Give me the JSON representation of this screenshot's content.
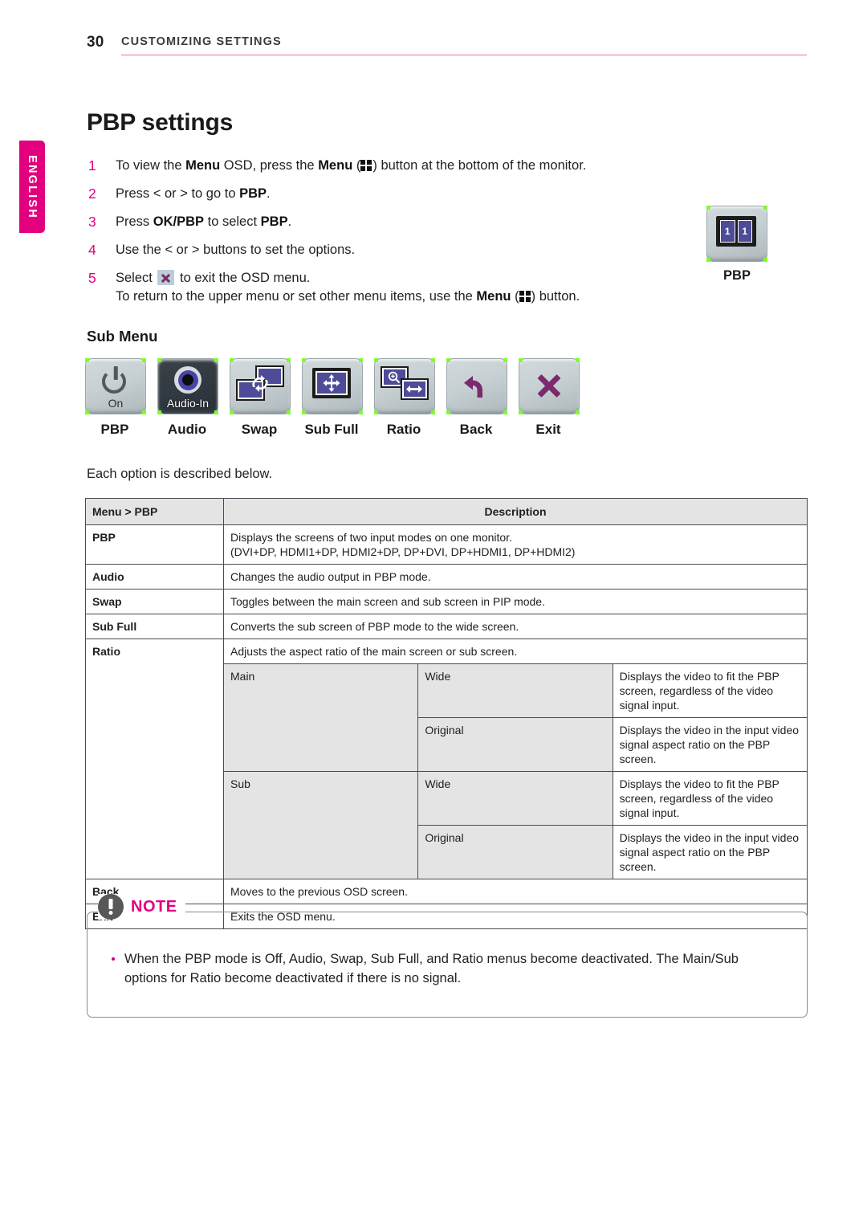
{
  "header": {
    "page_number": "30",
    "section_title": "CUSTOMIZING SETTINGS",
    "rule_color": "#f06ca8"
  },
  "language_tab": {
    "label": "ENGLISH",
    "color": "#e2007f"
  },
  "main_title": "PBP settings",
  "steps": [
    {
      "num": "1",
      "html": "To view the <b>Menu</b> OSD, press the <b>Menu</b> (<span class=\"menu-glyph\" data-name=\"menu-grid-icon\" data-interactable=\"false\"><i></i><i></i><i></i><i></i></span>) button at the bottom of the monitor."
    },
    {
      "num": "2",
      "html": "Press &lt; or &gt; to go to <b>PBP</b>."
    },
    {
      "num": "3",
      "html": "Press <b>OK/PBP</b> to select <b>PBP</b>."
    },
    {
      "num": "4",
      "html": "Use the &lt; or &gt; buttons to set the options."
    },
    {
      "num": "5",
      "html": "Select <span class=\"x-chip\" data-name=\"exit-x-icon\" data-interactable=\"false\"></span> to exit the OSD menu.<br>To return to the upper menu or set other menu items, use the <b>Menu</b> (<span class=\"menu-glyph\" data-name=\"menu-grid-icon\" data-interactable=\"false\"><i></i><i></i><i></i><i></i></span>) button."
    }
  ],
  "pbp_illustration": {
    "label": "PBP",
    "pane_left": "1",
    "pane_right": "1"
  },
  "sub_menu": {
    "title": "Sub Menu",
    "items": [
      {
        "label": "PBP",
        "icon": "power-icon",
        "caption": "On"
      },
      {
        "label": "Audio",
        "icon": "audio-in-icon",
        "caption": "Audio-In"
      },
      {
        "label": "Swap",
        "icon": "swap-icon",
        "caption": ""
      },
      {
        "label": "Sub Full",
        "icon": "sub-full-icon",
        "caption": ""
      },
      {
        "label": "Ratio",
        "icon": "ratio-icon",
        "caption": ""
      },
      {
        "label": "Back",
        "icon": "back-arrow-icon",
        "caption": ""
      },
      {
        "label": "Exit",
        "icon": "exit-x-icon",
        "caption": ""
      }
    ]
  },
  "each_option_line": "Each option is described below.",
  "table": {
    "headers": {
      "col1": "Menu > PBP",
      "col2": "Description"
    },
    "rows": [
      {
        "name": "PBP",
        "desc": "Displays the screens of two input modes on one monitor.\n(DVI+DP, HDMI1+DP, HDMI2+DP, DP+DVI, DP+HDMI1, DP+HDMI2)"
      },
      {
        "name": "Audio",
        "desc": "Changes the audio output in PBP mode."
      },
      {
        "name": "Swap",
        "desc": "Toggles between the main screen and sub screen in PIP mode."
      },
      {
        "name": "Sub Full",
        "desc": "Converts the sub screen of PBP mode to the wide screen."
      }
    ],
    "ratio": {
      "name": "Ratio",
      "desc": "Adjusts the aspect ratio of the main screen or sub screen.",
      "groups": [
        {
          "name": "Main",
          "options": [
            {
              "option": "Wide",
              "desc": "Displays the video to fit the PBP screen, regardless of the video signal input."
            },
            {
              "option": "Original",
              "desc": "Displays the video in the input video signal aspect ratio on the PBP screen."
            }
          ]
        },
        {
          "name": "Sub",
          "options": [
            {
              "option": "Wide",
              "desc": "Displays the video to fit the PBP screen, regardless of the video signal input."
            },
            {
              "option": "Original",
              "desc": "Displays the video in the input video signal aspect ratio on the PBP screen."
            }
          ]
        }
      ]
    },
    "trailing_rows": [
      {
        "name": "Back",
        "desc": "Moves to the previous OSD screen."
      },
      {
        "name": "Exit",
        "desc": "Exits the OSD menu."
      }
    ]
  },
  "note": {
    "title": "NOTE",
    "items": [
      "When the PBP mode is Off, Audio, Swap, Sub Full, and Ratio menus become deactivated. The Main/Sub options for Ratio become deactivated if there is no signal."
    ]
  }
}
